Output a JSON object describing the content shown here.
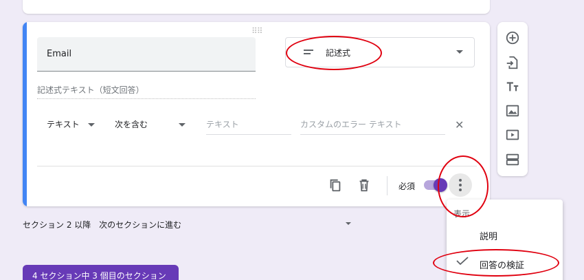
{
  "question": {
    "title_value": "Email",
    "type_label": "記述式",
    "answer_hint": "記述式テキスト（短文回答）"
  },
  "validation": {
    "type": "テキスト",
    "condition": "次を含む",
    "text_placeholder": "テキスト",
    "error_placeholder": "カスタムのエラー テキスト"
  },
  "footer": {
    "required_label": "必須"
  },
  "section_nav": {
    "label": "セクション 2 以降",
    "value": "次のセクションに進む"
  },
  "section_badge": "4 セクション中 3 個目のセクション",
  "menu": {
    "header": "表示",
    "items": [
      "説明",
      "回答の検証"
    ]
  },
  "colors": {
    "accent": "#4285f4",
    "brand": "#673ab7",
    "annotation": "#e0000f"
  }
}
